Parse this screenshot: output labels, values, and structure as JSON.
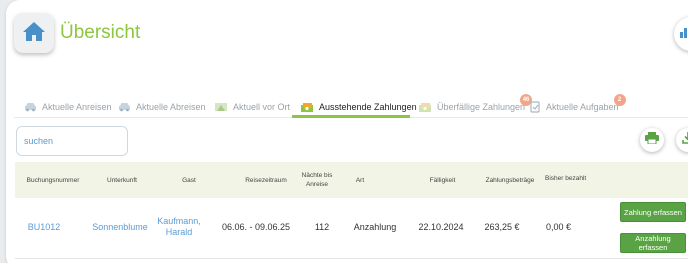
{
  "header": {
    "title": "Übersicht"
  },
  "tabs": [
    {
      "label": "Aktuelle Anreisen",
      "icon": "car-icon"
    },
    {
      "label": "Aktuelle Abreisen",
      "icon": "car-icon"
    },
    {
      "label": "Aktuell vor Ort",
      "icon": "tent-icon"
    },
    {
      "label": "Ausstehende Zahlungen",
      "icon": "money-icon",
      "active": true
    },
    {
      "label": "Überfällige Zahlungen",
      "icon": "money-icon",
      "badge": "46"
    },
    {
      "label": "Aktuelle Aufgaben",
      "icon": "task-icon",
      "badge": "2"
    }
  ],
  "search": {
    "value": "suchen"
  },
  "table": {
    "columns": [
      "Buchungsnummer",
      "Unterkunft",
      "Gast",
      "Reisezeitraum",
      "Nächte bis Anreise",
      "Art",
      "Fälligkeit",
      "Zahlungsbeträge",
      "Bisher bezahlt"
    ],
    "rows": [
      {
        "buchungsnummer": "BU1012",
        "unterkunft": "Sonnenblume",
        "gast": "Kaufmann, Harald",
        "reisezeitraum": "06.06. - 09.06.25",
        "naechte": "112",
        "art": "Anzahlung",
        "faelligkeit": "22.10.2024",
        "betrag": "263,25 €",
        "bezahlt": "0,00 €"
      }
    ],
    "actions": {
      "zahlung": "Zahlung erfassen",
      "anzahlung": "Anzahlung erfassen"
    }
  },
  "colors": {
    "accent": "#8dc63f",
    "link": "#5b9bd5",
    "button": "#5aa344",
    "badge": "#f2a58a"
  }
}
